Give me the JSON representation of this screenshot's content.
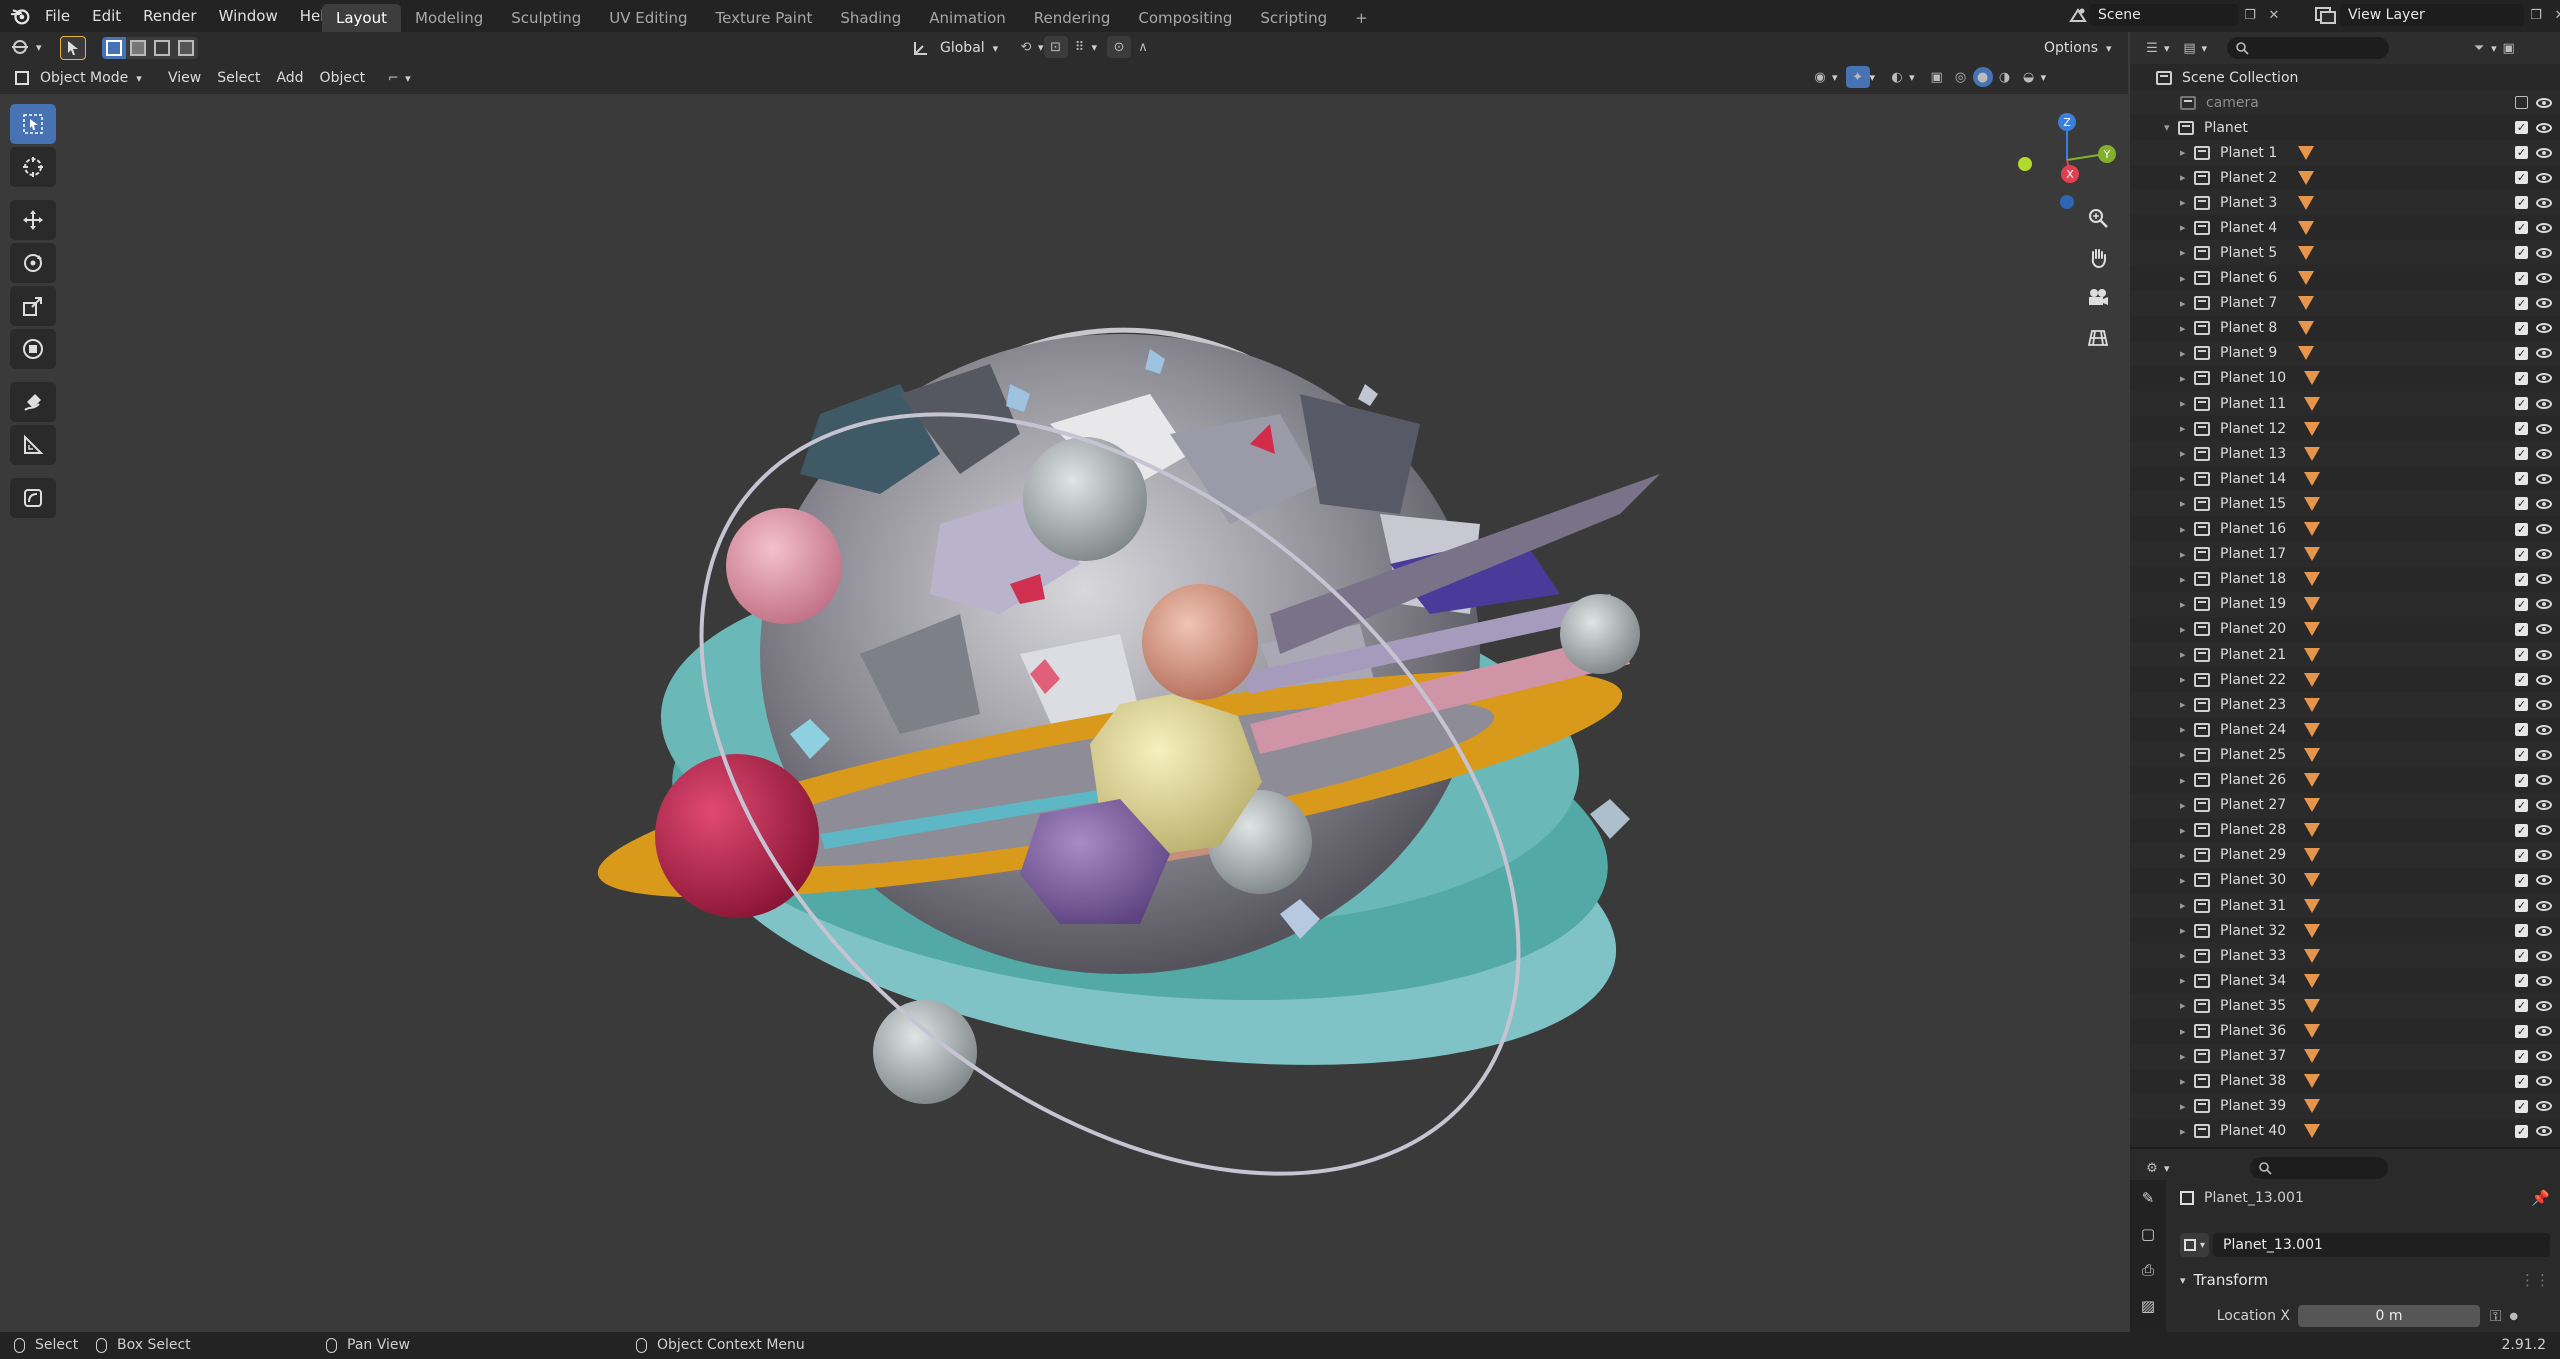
{
  "app": {
    "menus": [
      "File",
      "Edit",
      "Render",
      "Window",
      "Help"
    ],
    "workspace_tabs": [
      "Layout",
      "Modeling",
      "Sculpting",
      "UV Editing",
      "Texture Paint",
      "Shading",
      "Animation",
      "Rendering",
      "Compositing",
      "Scripting"
    ],
    "active_workspace": "Layout",
    "add_tab": "+",
    "scene_name": "Scene",
    "view_layer_name": "View Layer"
  },
  "viewport_header": {
    "options_label": "Options",
    "mode": "Object Mode",
    "menus": [
      "View",
      "Select",
      "Add",
      "Object"
    ],
    "transform_orientation": "Global"
  },
  "gizmo": {
    "z": "Z",
    "y": "Y",
    "x": "X",
    "colors": {
      "x": "#e0404f",
      "y": "#83b02b",
      "z": "#3a7fdc"
    }
  },
  "outliner": {
    "scene_collection": "Scene Collection",
    "camera": "camera",
    "planet_collection": "Planet",
    "planets": [
      "Planet 1",
      "Planet 2",
      "Planet 3",
      "Planet 4",
      "Planet 5",
      "Planet 6",
      "Planet 7",
      "Planet 8",
      "Planet 9",
      "Planet 10",
      "Planet 11",
      "Planet 12",
      "Planet 13",
      "Planet 14",
      "Planet 15",
      "Planet 16",
      "Planet 17",
      "Planet 18",
      "Planet 19",
      "Planet 20",
      "Planet 21",
      "Planet 22",
      "Planet 23",
      "Planet 24",
      "Planet 25",
      "Planet 26",
      "Planet 27",
      "Planet 28",
      "Planet 29",
      "Planet 30",
      "Planet 31",
      "Planet 32",
      "Planet 33",
      "Planet 34",
      "Planet 35",
      "Planet 36",
      "Planet 37",
      "Planet 38",
      "Planet 39",
      "Planet 40"
    ],
    "check_mark": "✓"
  },
  "properties": {
    "object_name": "Planet_13.001",
    "data_name": "Planet_13.001",
    "panel_transform": "Transform",
    "location_x_label": "Location X",
    "location_x_value": "0 m"
  },
  "statusbar": {
    "select": "Select",
    "box_select": "Box Select",
    "pan_view": "Pan View",
    "context_menu": "Object Context Menu",
    "version": "2.91.2"
  },
  "colors": {
    "accent": "#4772b3",
    "mesh_icon": "#e6954a"
  }
}
